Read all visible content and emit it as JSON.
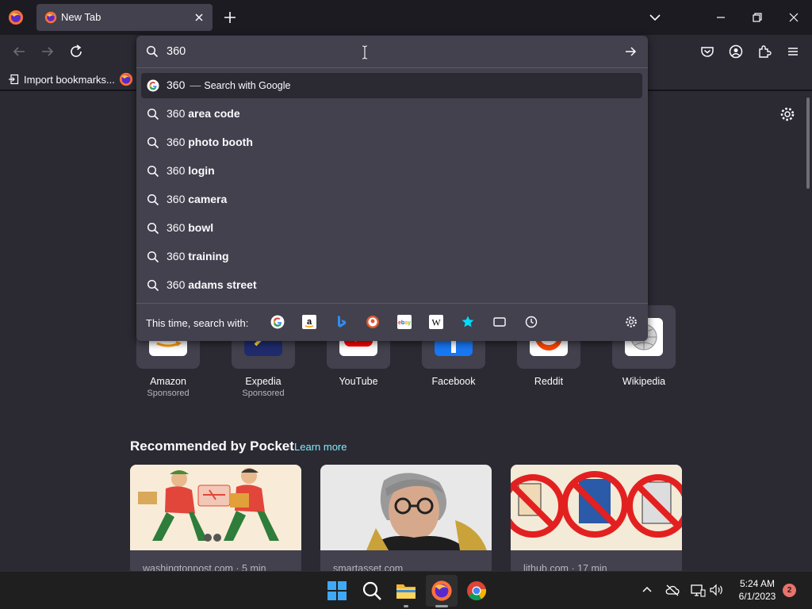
{
  "window": {
    "tab_title": "New Tab"
  },
  "bookmarks": {
    "import_label": "Import bookmarks..."
  },
  "urlbar": {
    "value": "360",
    "suggestions": [
      {
        "prefix": "360",
        "action": "Search with Google",
        "icon": "google-icon"
      },
      {
        "prefix": "360",
        "bold": "area code",
        "icon": "search-icon"
      },
      {
        "prefix": "360",
        "bold": "photo booth",
        "icon": "search-icon"
      },
      {
        "prefix": "360",
        "bold": "login",
        "icon": "search-icon"
      },
      {
        "prefix": "360",
        "bold": "camera",
        "icon": "search-icon"
      },
      {
        "prefix": "360",
        "bold": "bowl",
        "icon": "search-icon"
      },
      {
        "prefix": "360",
        "bold": "training",
        "icon": "search-icon"
      },
      {
        "prefix": "360",
        "bold": "adams street",
        "icon": "search-icon"
      }
    ],
    "dash": "—",
    "oneoff_label": "This time, search with:",
    "oneoff_engines": [
      "google",
      "amazon",
      "bing",
      "duckduckgo",
      "ebay",
      "wikipedia",
      "bookmarks",
      "tabs",
      "history"
    ]
  },
  "top_sites": [
    {
      "label": "Amazon",
      "sponsored": "Sponsored"
    },
    {
      "label": "Expedia",
      "sponsored": "Sponsored"
    },
    {
      "label": "YouTube",
      "sponsored": ""
    },
    {
      "label": "Facebook",
      "sponsored": ""
    },
    {
      "label": "Reddit",
      "sponsored": ""
    },
    {
      "label": "Wikipedia",
      "sponsored": ""
    }
  ],
  "pocket": {
    "heading": "Recommended by Pocket",
    "learn_more": "Learn more",
    "cards": [
      {
        "source": "washingtonpost.com · 5 min"
      },
      {
        "source": "smartasset.com"
      },
      {
        "source": "lithub.com · 17 min"
      }
    ]
  },
  "taskbar": {
    "time": "5:24 AM",
    "date": "6/1/2023",
    "notifications": "2"
  },
  "colors": {
    "accent": "#80ebff",
    "background": "#2b2a33",
    "panel": "#42414d"
  }
}
